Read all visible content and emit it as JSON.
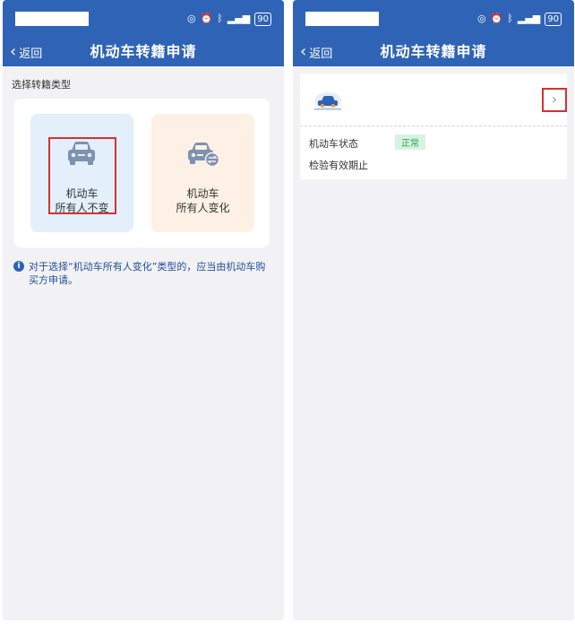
{
  "left_screen": {
    "nav": {
      "back_label": "返回",
      "title": "机动车转籍申请"
    },
    "section_label": "选择转籍类型",
    "options": [
      {
        "line1": "机动车",
        "line2": "所有人不变",
        "icon": "car-icon"
      },
      {
        "line1": "机动车",
        "line2": "所有人变化",
        "icon": "car-transfer-icon"
      }
    ],
    "notice": "对于选择“机动车所有人变化”类型的，应当由机动车购买方申请。"
  },
  "right_screen": {
    "nav": {
      "back_label": "返回",
      "title": "机动车转籍申请"
    },
    "vehicle": {
      "status_label": "机动车状态",
      "status_value": "正常",
      "inspection_label": "检验有效期止"
    }
  },
  "status_bar": {
    "battery": "90"
  },
  "colors": {
    "header_blue": "#2f63b6",
    "highlight_red": "#d23232",
    "status_green": "#2aa35a"
  }
}
